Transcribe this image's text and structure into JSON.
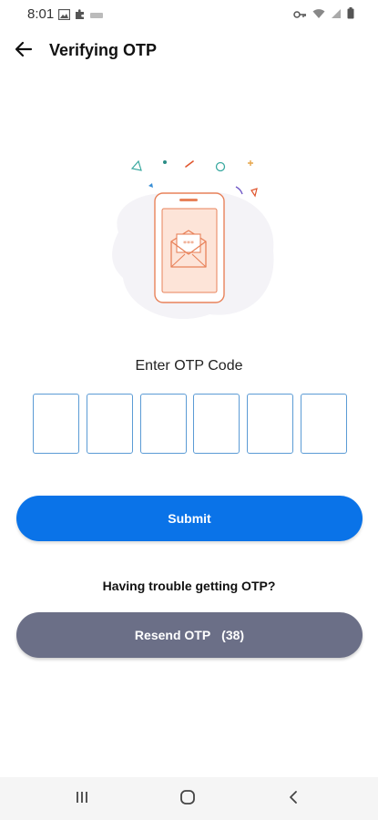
{
  "status_bar": {
    "time": "8:01",
    "left_icons": [
      "image-icon",
      "puzzle-icon",
      "sms-icon"
    ],
    "right_icons": [
      "key-icon",
      "wifi-icon",
      "signal-icon",
      "battery-icon"
    ]
  },
  "header": {
    "title": "Verifying OTP",
    "back_icon": "arrow-left-icon"
  },
  "illustration": {
    "icon": "phone-envelope-icon",
    "accent": "#e8825a"
  },
  "otp": {
    "label": "Enter OTP Code",
    "digits": [
      "",
      "",
      "",
      "",
      "",
      ""
    ]
  },
  "actions": {
    "submit_label": "Submit",
    "trouble_text": "Having trouble getting OTP?",
    "resend_label": "Resend OTP",
    "resend_count": "(38)"
  },
  "nav_bar": {
    "buttons": [
      "recent-apps-icon",
      "home-icon",
      "back-icon"
    ]
  },
  "colors": {
    "primary": "#0a73e8",
    "secondary": "#6b6f87",
    "otp_border": "#5b9bd5"
  }
}
